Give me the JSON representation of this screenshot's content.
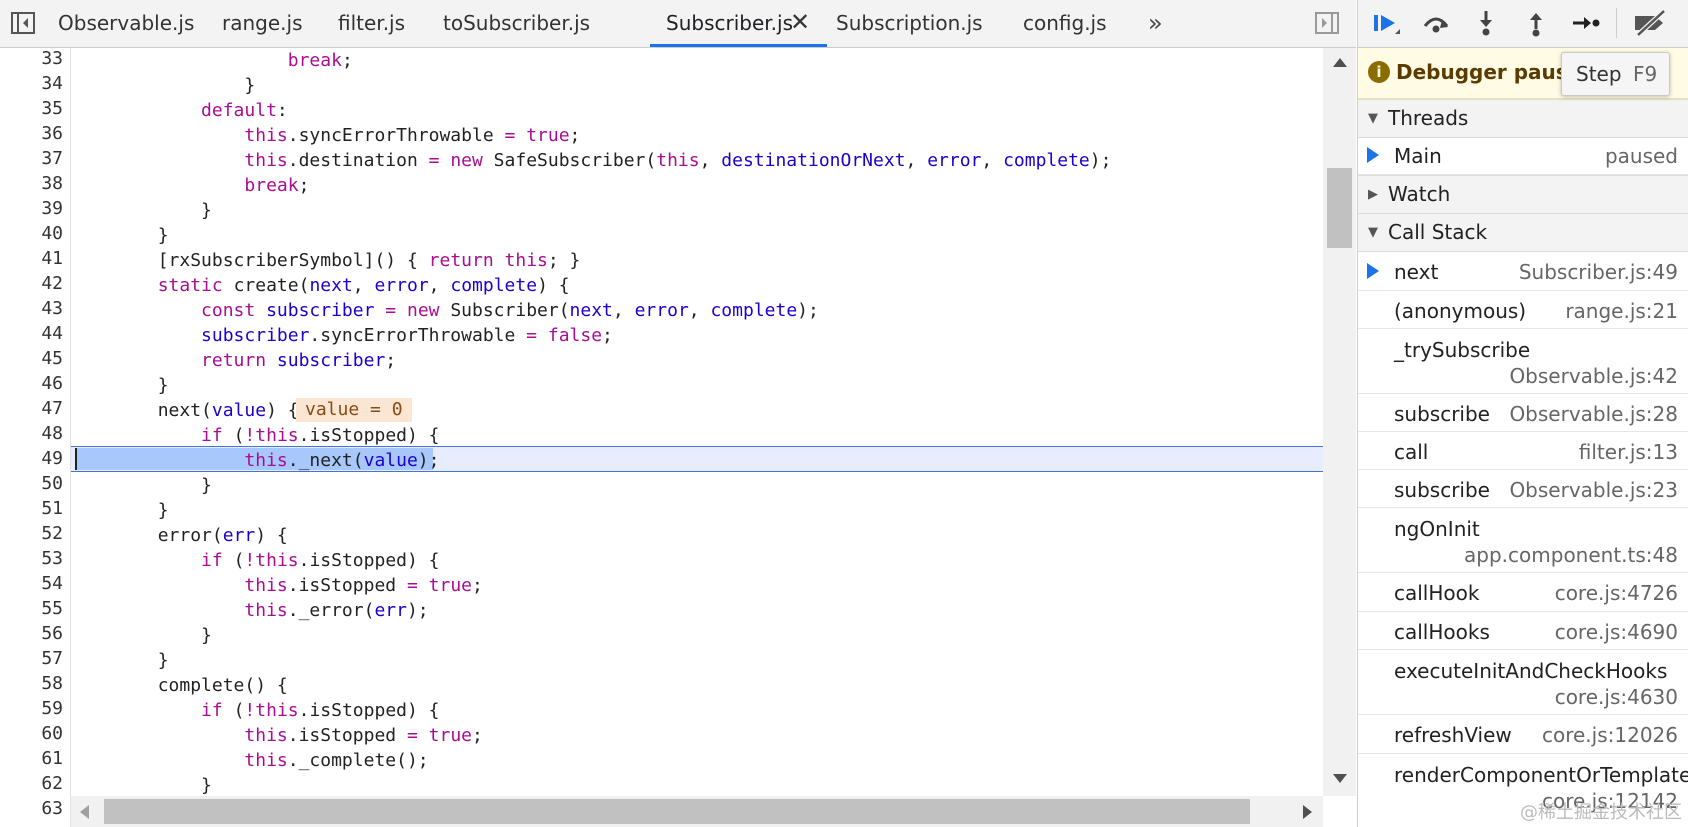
{
  "tabs": [
    {
      "label": "Observable.js"
    },
    {
      "label": "range.js"
    },
    {
      "label": "filter.js"
    },
    {
      "label": "toSubscriber.js"
    },
    {
      "label": "Subscriber.js"
    },
    {
      "label": "Subscription.js"
    },
    {
      "label": "config.js"
    }
  ],
  "tab_close_glyph": "✕",
  "more_glyph": "»",
  "editor": {
    "line_numbers": [
      "33",
      "34",
      "35",
      "36",
      "37",
      "38",
      "39",
      "40",
      "41",
      "42",
      "43",
      "44",
      "45",
      "46",
      "47",
      "48",
      "49",
      "50",
      "51",
      "52",
      "53",
      "54",
      "55",
      "56",
      "57",
      "58",
      "59",
      "60",
      "61",
      "62",
      "63"
    ],
    "inline_value": "value = 0",
    "current_line": "49"
  },
  "debugger": {
    "paused_message": "Debugger paused",
    "tooltip_label": "Step",
    "tooltip_shortcut": "F9",
    "info_glyph": "i",
    "sections": {
      "threads": "Threads",
      "watch": "Watch",
      "callstack": "Call Stack"
    },
    "thread": {
      "name": "Main",
      "status": "paused"
    },
    "callstack": [
      {
        "fn": "next",
        "loc": "Subscriber.js:49"
      },
      {
        "fn": "(anonymous)",
        "loc": "range.js:21"
      },
      {
        "fn": "_trySubscribe",
        "loc": "Observable.js:42"
      },
      {
        "fn": "subscribe",
        "loc": "Observable.js:28"
      },
      {
        "fn": "call",
        "loc": "filter.js:13"
      },
      {
        "fn": "subscribe",
        "loc": "Observable.js:23"
      },
      {
        "fn": "ngOnInit",
        "loc": "app.component.ts:48"
      },
      {
        "fn": "callHook",
        "loc": "core.js:4726"
      },
      {
        "fn": "callHooks",
        "loc": "core.js:4690"
      },
      {
        "fn": "executeInitAndCheckHooks",
        "loc": "core.js:4630"
      },
      {
        "fn": "refreshView",
        "loc": "core.js:12026"
      },
      {
        "fn": "renderComponentOrTemplate",
        "loc": "core.js:12142"
      }
    ]
  },
  "watermark": "@稀土掘金技术社区",
  "colors": {
    "accent": "#1a73e8",
    "selection": "#a8c7fa",
    "current_line": "#e8edfd",
    "inline_value_bg": "#fbe6d4",
    "paused_banner": "#fffbe5"
  }
}
